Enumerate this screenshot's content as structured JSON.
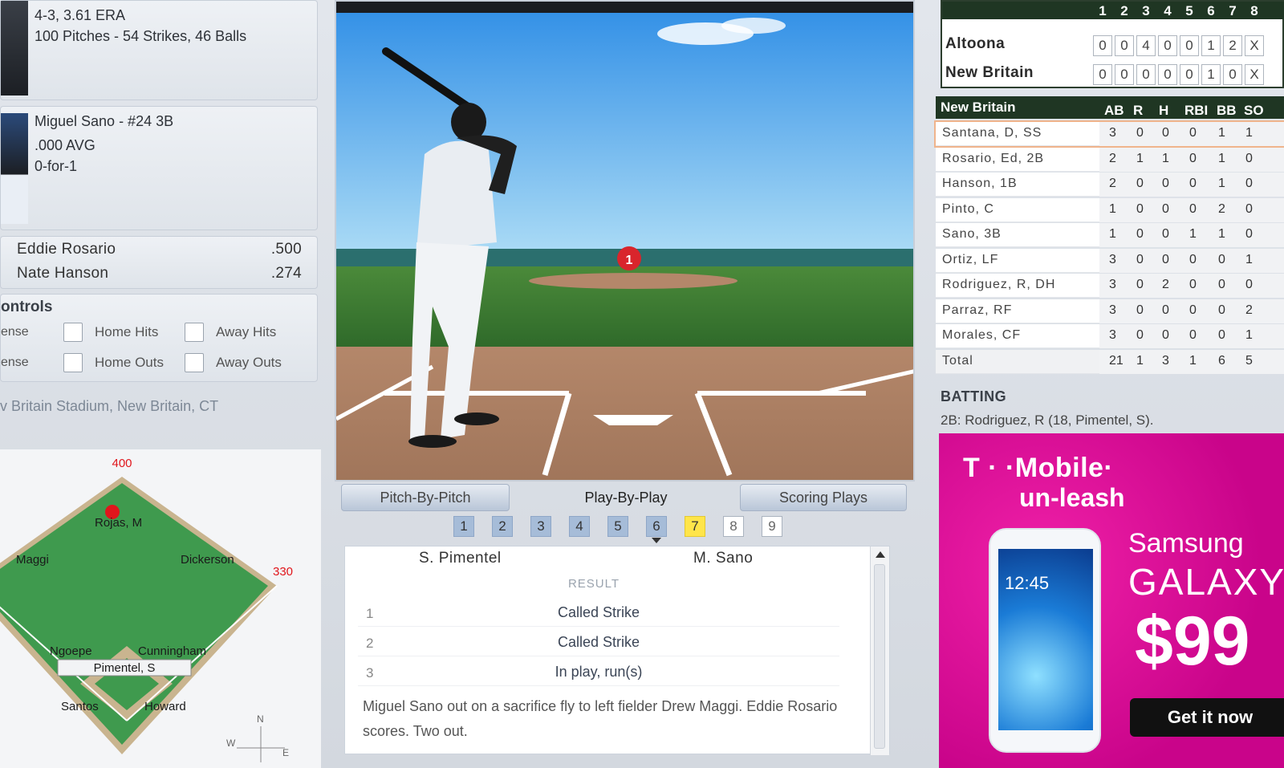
{
  "pitcher": {
    "record": "4-3, 3.61 ERA",
    "pitches": "100 Pitches - 54 Strikes, 46 Balls"
  },
  "batter": {
    "name": "Miguel Sano - #24 3B",
    "avg": ".000 AVG",
    "line": "0-for-1"
  },
  "runners": [
    {
      "name": "Eddie Rosario",
      "avg": ".500"
    },
    {
      "name": "Nate Hanson",
      "avg": ".274"
    }
  ],
  "controls": {
    "title": "ontrols",
    "rows": [
      {
        "label": "ense",
        "home": "Home Hits",
        "away": "Away Hits"
      },
      {
        "label": "ense",
        "home": "Home Outs",
        "away": "Away Outs"
      }
    ]
  },
  "stadium": "v Britain Stadium, New Britain, CT",
  "field": {
    "distance_center": "400",
    "distance_right": "330",
    "fielders": {
      "cf": "Rojas, M",
      "lf": "Maggi",
      "rf": "Dickerson",
      "ss": "Ngoepe",
      "b2": "Cunningham",
      "pitcher": "Pimentel, S",
      "b3": "Santos",
      "b1": "Howard"
    },
    "compass": {
      "n": "N",
      "w": "W",
      "e": "E"
    }
  },
  "gameview": {
    "ball_number": "1"
  },
  "tabs": {
    "pitch": "Pitch-By-Pitch",
    "play": "Play-By-Play",
    "scoring": "Scoring Plays"
  },
  "innings": [
    "1",
    "2",
    "3",
    "4",
    "5",
    "6",
    "7",
    "8",
    "9"
  ],
  "pbp": {
    "pitcher": "S. Pimentel",
    "batter": "M. Sano",
    "result_label": "RESULT",
    "pitches": [
      {
        "num": "1",
        "result": "Called Strike"
      },
      {
        "num": "2",
        "result": "Called Strike"
      },
      {
        "num": "3",
        "result": "In play, run(s)"
      }
    ],
    "description": "Miguel Sano out on a sacrifice fly to left fielder Drew Maggi.   Eddie Rosario scores.  Two out."
  },
  "linescore": {
    "innings": [
      "1",
      "2",
      "3",
      "4",
      "5",
      "6",
      "7",
      "8"
    ],
    "teams": [
      {
        "name": "Altoona",
        "runs": [
          "0",
          "0",
          "4",
          "0",
          "0",
          "1",
          "2",
          "X"
        ]
      },
      {
        "name": "New Britain",
        "runs": [
          "0",
          "0",
          "0",
          "0",
          "0",
          "1",
          "0",
          "X"
        ]
      }
    ]
  },
  "boxscore": {
    "team": "New Britain",
    "columns": [
      "AB",
      "R",
      "H",
      "RBI",
      "BB",
      "SO"
    ],
    "rows": [
      {
        "name": "Santana, D, SS",
        "stats": [
          "3",
          "0",
          "0",
          "0",
          "1",
          "1"
        ]
      },
      {
        "name": "Rosario, Ed, 2B",
        "stats": [
          "2",
          "1",
          "1",
          "0",
          "1",
          "0"
        ]
      },
      {
        "name": "Hanson, 1B",
        "stats": [
          "2",
          "0",
          "0",
          "0",
          "1",
          "0"
        ]
      },
      {
        "name": "Pinto, C",
        "stats": [
          "1",
          "0",
          "0",
          "0",
          "2",
          "0"
        ]
      },
      {
        "name": "Sano, 3B",
        "stats": [
          "1",
          "0",
          "0",
          "1",
          "1",
          "0"
        ]
      },
      {
        "name": "Ortiz, LF",
        "stats": [
          "3",
          "0",
          "0",
          "0",
          "0",
          "1"
        ]
      },
      {
        "name": "Rodriguez, R, DH",
        "stats": [
          "3",
          "0",
          "2",
          "0",
          "0",
          "0"
        ]
      },
      {
        "name": "Parraz, RF",
        "stats": [
          "3",
          "0",
          "0",
          "0",
          "0",
          "2"
        ]
      },
      {
        "name": "Morales, CF",
        "stats": [
          "3",
          "0",
          "0",
          "0",
          "0",
          "1"
        ]
      }
    ],
    "total": {
      "name": "Total",
      "stats": [
        "21",
        "1",
        "3",
        "1",
        "6",
        "5"
      ]
    }
  },
  "batting": {
    "title": "BATTING",
    "line": "2B: Rodriguez, R (18, Pimentel, S)."
  },
  "ad": {
    "brand": "T · ·Mobile·",
    "tagline": "un-leash",
    "clock": "12:45",
    "samsung": "Samsung",
    "galaxy": "GALAXY",
    "price": "$99",
    "cta": "Get it now"
  },
  "colors": {
    "accent_green": "#1f3623",
    "highlight": "#ffe54a",
    "ad_magenta": "#e0109c"
  }
}
